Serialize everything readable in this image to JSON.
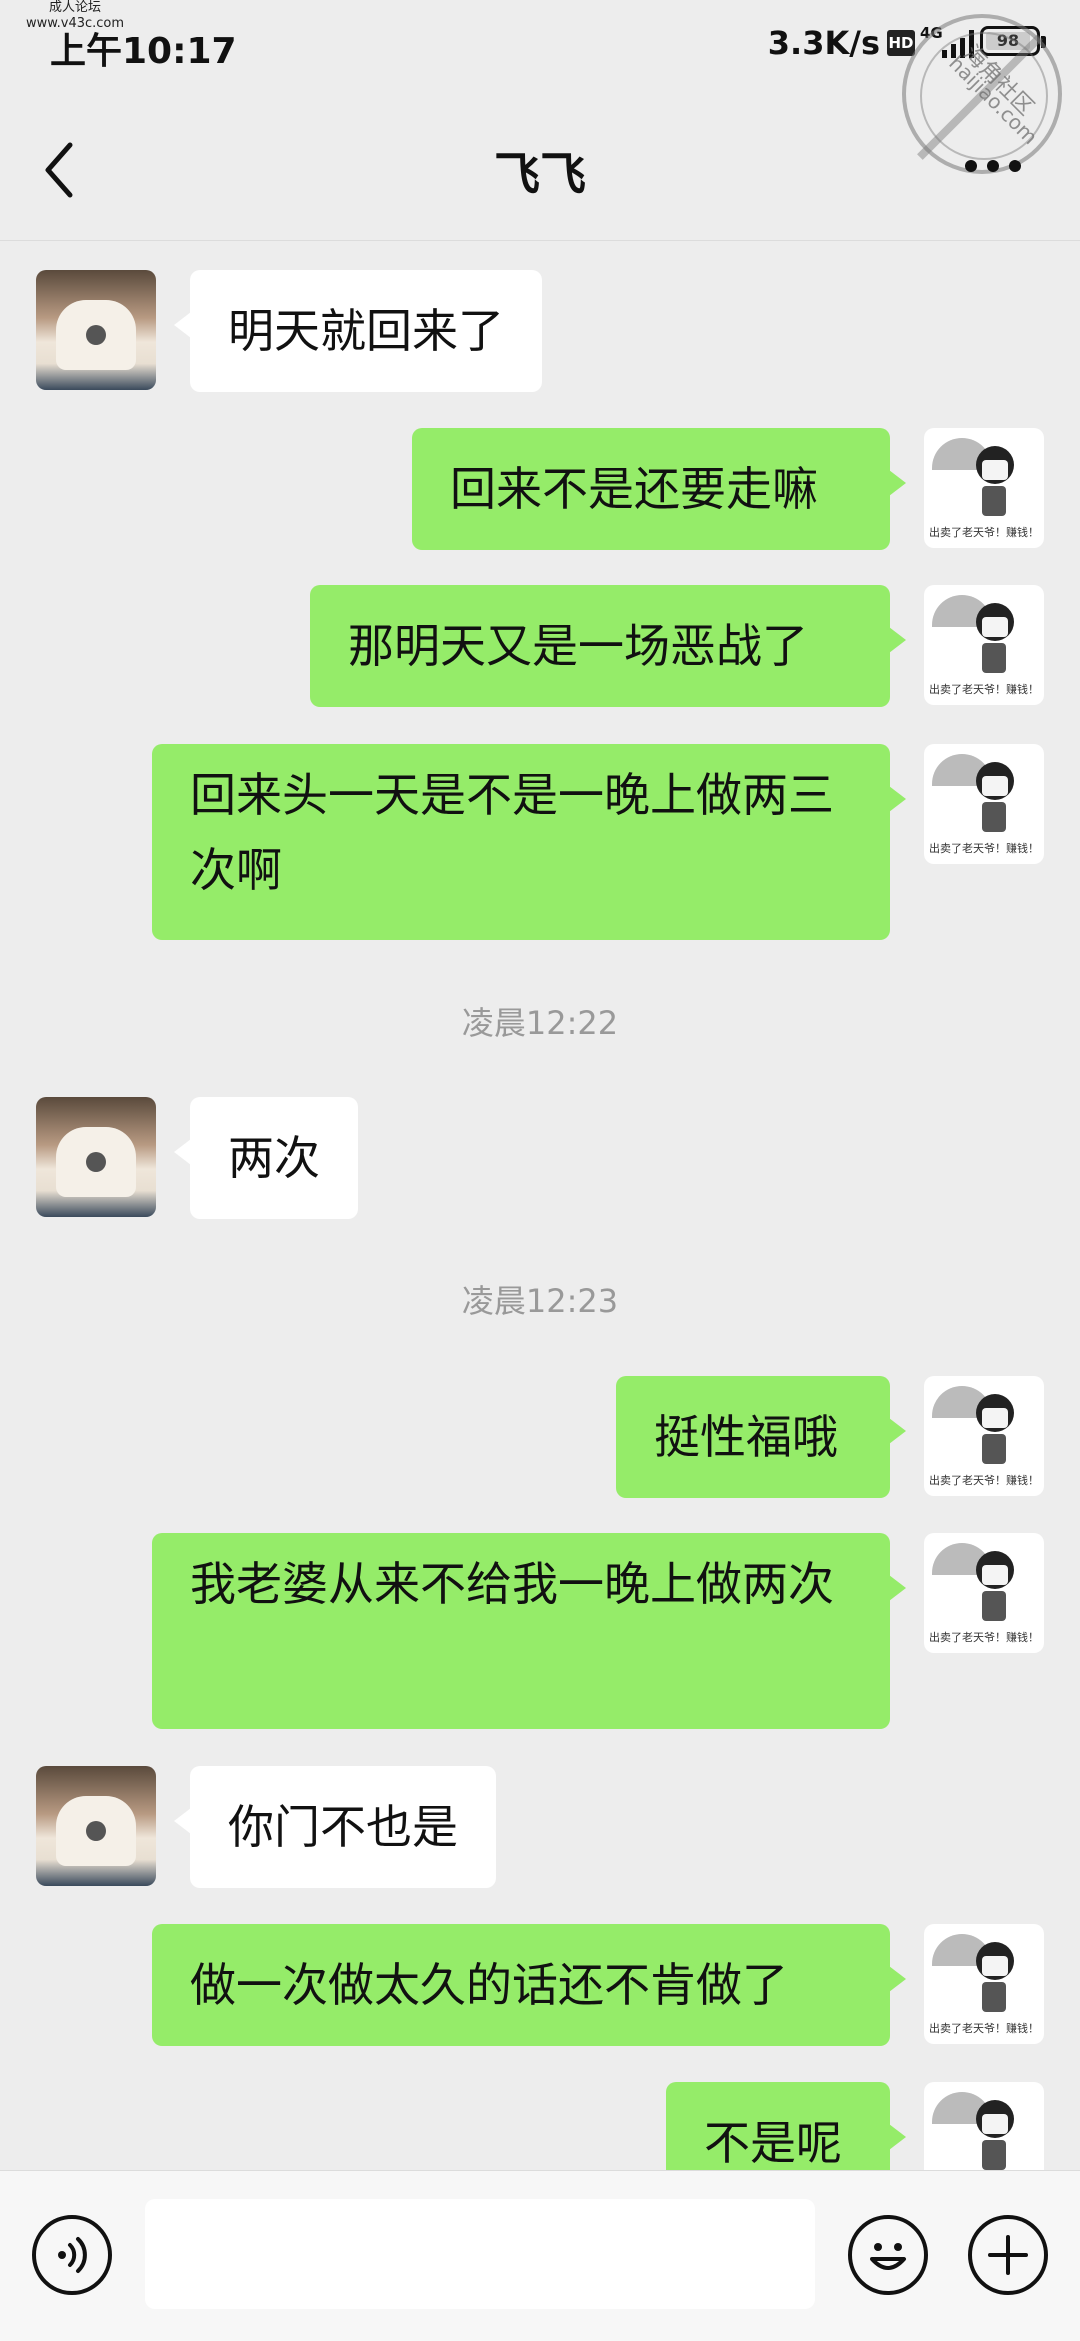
{
  "watermark": {
    "top_left_line1": "成人论坛",
    "top_left_line2": "www.v43c.com",
    "stamp_line1": "海角社区",
    "stamp_line2": "haijiao.com"
  },
  "status_bar": {
    "time": "上午10:17",
    "net_speed": "3.3K/s",
    "hd": "HD",
    "network": "4G",
    "battery": "98"
  },
  "header": {
    "title": "飞飞",
    "back_icon": "chevron-left-icon",
    "more_icon": "more-dots-icon"
  },
  "avatar_caption": "出卖了老天爷！赚钱！",
  "messages": [
    {
      "side": "in",
      "text": "明天就回来了"
    },
    {
      "side": "out",
      "text": "回来不是还要走嘛"
    },
    {
      "side": "out",
      "text": "那明天又是一场恶战了"
    },
    {
      "side": "out",
      "text": "回来头一天是不是一晚上做两三次啊"
    },
    {
      "side": "time",
      "text": "凌晨12:22"
    },
    {
      "side": "in",
      "text": "两次"
    },
    {
      "side": "time",
      "text": "凌晨12:23"
    },
    {
      "side": "out",
      "text": "挺性福哦"
    },
    {
      "side": "out",
      "text": "我老婆从来不给我一晚上做两次"
    },
    {
      "side": "in",
      "text": "你门不也是"
    },
    {
      "side": "out",
      "text": "做一次做太久的话还不肯做了"
    },
    {
      "side": "out",
      "text": "不是呢"
    }
  ],
  "input_bar": {
    "voice_icon": "voice-icon",
    "emoji_icon": "emoji-icon",
    "plus_icon": "plus-icon",
    "value": ""
  }
}
